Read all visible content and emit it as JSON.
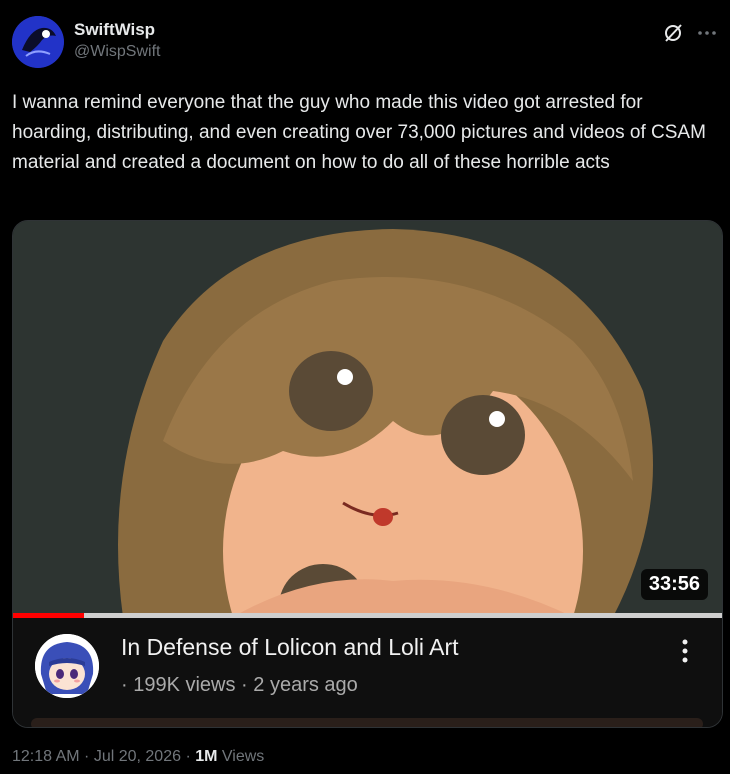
{
  "author": {
    "display_name": "SwiftWisp",
    "handle": "@WispSwift"
  },
  "icons": {
    "grok": "grok-icon",
    "more": "more-options-icon"
  },
  "tweet": {
    "text": "I wanna remind everyone that the guy who made this video got arrested for hoarding, distributing, and even creating over 73,000 pictures and videos of CSAM material and created a document on how to do all of these horrible acts"
  },
  "video_card": {
    "duration": "33:56",
    "progress_fraction": 0.1,
    "title": "In Defense of Lolicon and Loli Art",
    "meta": "· 199K views · 2 years ago",
    "accent": "#ff0000"
  },
  "footer": {
    "timestamp": "12:18 AM · Jul 20, 2026 · ",
    "views_count": "1M",
    "views_label": " Views"
  }
}
